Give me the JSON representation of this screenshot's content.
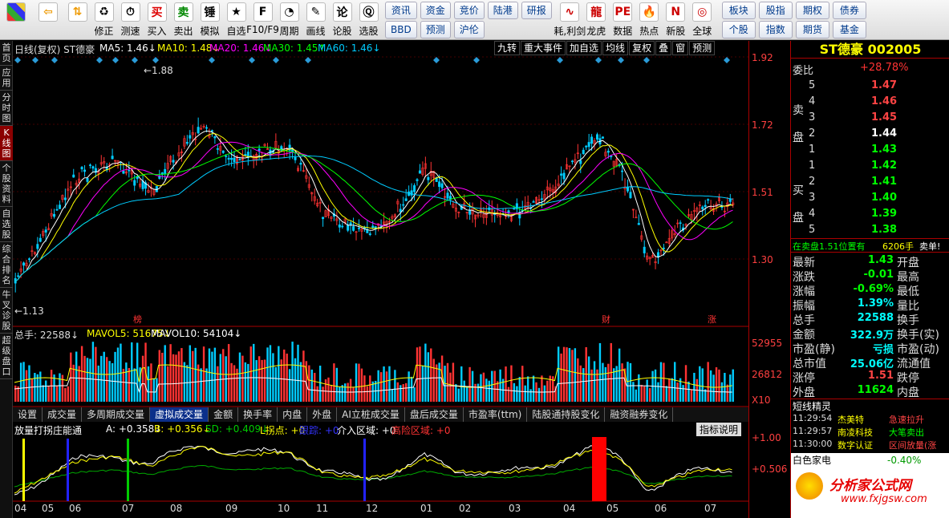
{
  "toolbar": {
    "row1": [
      "修正",
      "测速",
      "买入",
      "卖出",
      "模拟",
      "自选",
      "F10/F9",
      "周期",
      "画线",
      "论股",
      "选股"
    ],
    "grp": [
      "资讯",
      "资金",
      "竞价",
      "陆港",
      "研报",
      "BBD",
      "预测",
      "沪伦"
    ],
    "row2": [
      "耗,利剑",
      "龙虎",
      "数据",
      "热点",
      "新股",
      "全球"
    ],
    "grp2": [
      "板块",
      "股指",
      "期权",
      "债券",
      "个股",
      "指数",
      "期货",
      "基金"
    ]
  },
  "sidetabs": [
    "首页",
    "应用",
    "分时图",
    "K线图",
    "个股资料",
    "自选股",
    "综合排名",
    "牛叉诊股",
    "超级盘口"
  ],
  "kline": {
    "header": "日线(复权)  ST德豪",
    "ma5": "MA5: 1.46↓",
    "ma10": "MA10: 1.48↓",
    "ma20": "MA20: 1.46↓",
    "ma30": "MA30: 1.45↑",
    "ma60": "MA60: 1.46↓",
    "buttons": [
      "九转",
      "重大事件",
      "加自选",
      "均线",
      "复权",
      "叠",
      "窗",
      "预测"
    ],
    "high": "←1.88",
    "low": "←1.13",
    "yticks": [
      "1.92",
      "1.72",
      "1.51",
      "1.30"
    ],
    "marks": [
      "榜",
      "财",
      "涨"
    ],
    "watermark": "分析家公式网www.fxjgsw.com"
  },
  "volume": {
    "header": "总手: 22588↓",
    "mavol5": "MAVOL5: 51675↓",
    "mavol10": "MAVOL10: 54104↓",
    "yticks": [
      "52955",
      "26812",
      "X10"
    ]
  },
  "tabs": [
    "设置",
    "成交量",
    "多周期成交量",
    "虚拟成交量",
    "金额",
    "换手率",
    "内盘",
    "外盘",
    "AI立桩成交量",
    "盘后成交量",
    "市盈率(ttm)",
    "陆股通持股变化",
    "融资融券变化"
  ],
  "indicator": {
    "name": "放量打拐庄能通",
    "a": "A: +0.358↓",
    "b": "B: +0.356↓",
    "sd": "SD: +0.409↓",
    "l": "L拐点: +0",
    "track": "跟踪: +0",
    "zone": "介入区域: +0",
    "risk": "高险区域: +0",
    "help": "指标说明",
    "yticks": [
      "+1.00",
      "+0.506"
    ]
  },
  "months": [
    "04",
    "05",
    "06",
    "07",
    "08",
    "09",
    "10",
    "11",
    "12",
    "01",
    "02",
    "03",
    "04",
    "05",
    "06",
    "07"
  ],
  "quote": {
    "title": "ST德豪 002005",
    "weibi_label": "委比",
    "weibi": "+28.78%",
    "sell": [
      [
        "5",
        "1.47"
      ],
      [
        "4",
        "1.46"
      ],
      [
        "3",
        "1.45"
      ],
      [
        "2",
        "1.44"
      ],
      [
        "1",
        "1.43"
      ]
    ],
    "buy": [
      [
        "1",
        "1.42"
      ],
      [
        "2",
        "1.41"
      ],
      [
        "3",
        "1.40"
      ],
      [
        "4",
        "1.39"
      ],
      [
        "5",
        "1.38"
      ]
    ],
    "sell_label": "卖盘",
    "buy_label": "买盘",
    "notice": "在卖盘1.51位置有",
    "notice_vol": "6206手",
    "notice_tag": "卖单!",
    "stats": [
      [
        "最新",
        "1.43",
        "开盘",
        ""
      ],
      [
        "涨跌",
        "-0.01",
        "最高",
        ""
      ],
      [
        "涨幅",
        "-0.69%",
        "最低",
        ""
      ],
      [
        "振幅",
        "1.39%",
        "量比",
        ""
      ],
      [
        "总手",
        "22588",
        "换手",
        ""
      ],
      [
        "金额",
        "322.9万",
        "换手(实)",
        ""
      ],
      [
        "市盈(静)",
        "亏损",
        "市盈(动)",
        ""
      ],
      [
        "总市值",
        "25.06亿",
        "流通值",
        ""
      ],
      [
        "涨停",
        "1.51",
        "跌停",
        ""
      ],
      [
        "外盘",
        "11624",
        "内盘",
        ""
      ]
    ],
    "elf_title": "短线精灵",
    "elf": [
      [
        "11:29:54",
        "杰美特",
        "急速拉升"
      ],
      [
        "11:29:57",
        "南凌科技",
        "大笔卖出"
      ],
      [
        "11:30:00",
        "数字认证",
        "区间放量(涨"
      ]
    ],
    "footer_name": "白色家电",
    "footer_pct": "-0.40%",
    "logo": "分析家公式网",
    "logo_url": "www.fxjgsw.com"
  }
}
